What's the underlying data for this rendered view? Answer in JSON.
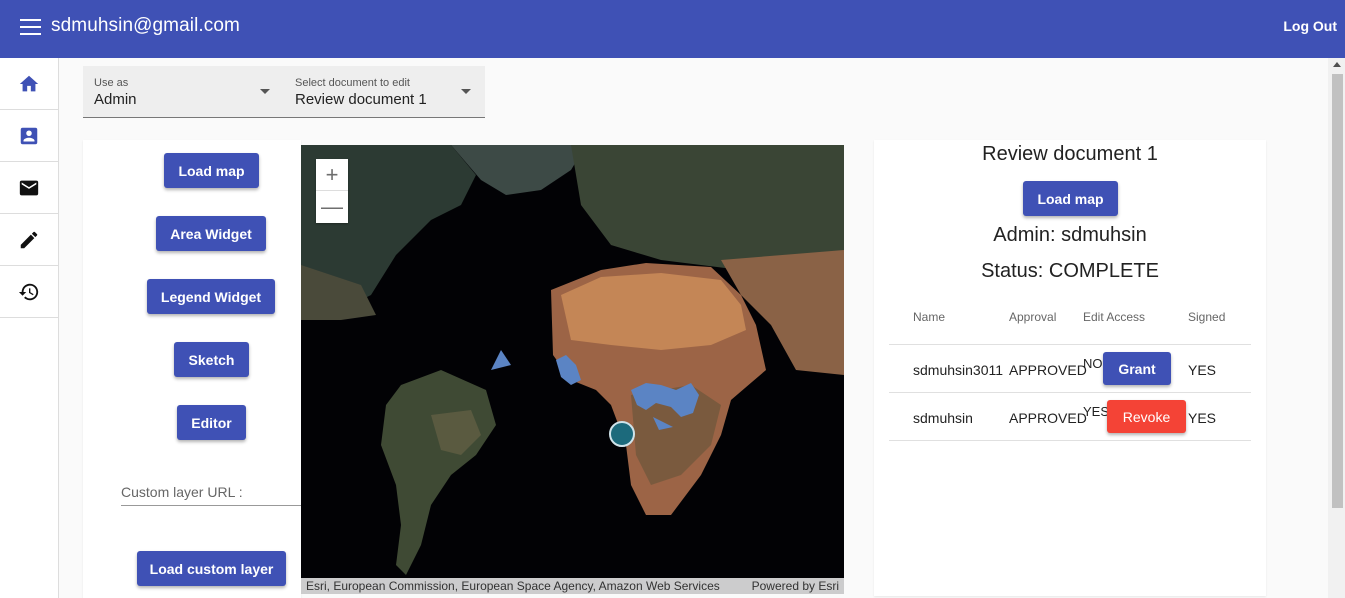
{
  "header": {
    "title": "sdmuhsin@gmail.com",
    "logout_label": "Log Out"
  },
  "drawer": {
    "items": [
      {
        "icon": "home-icon"
      },
      {
        "icon": "contact-icon"
      },
      {
        "icon": "mail-icon"
      },
      {
        "icon": "edit-icon"
      },
      {
        "icon": "history-icon"
      }
    ]
  },
  "selects": {
    "use_as": {
      "label": "Use as",
      "value": "Admin"
    },
    "document": {
      "label": "Select document to edit",
      "value": "Review document 1"
    }
  },
  "tools": {
    "load_map": "Load map",
    "area_widget": "Area Widget",
    "legend_widget": "Legend Widget",
    "sketch": "Sketch",
    "editor": "Editor",
    "custom_layer_placeholder": "Custom layer URL :",
    "load_custom_layer": "Load custom layer"
  },
  "map": {
    "zoom_in": "+",
    "zoom_out": "—",
    "attribution": "Esri, European Commission, European Space Agency, Amazon Web Services",
    "powered_by": "Powered by Esri"
  },
  "document_panel": {
    "title": "Review document 1",
    "load_map": "Load map",
    "admin_label": "Admin:",
    "admin_value": "sdmuhsin",
    "status_label": "Status:",
    "status_value": "COMPLETE",
    "columns": [
      "Name",
      "Approval",
      "Edit Access",
      "Signed"
    ],
    "rows": [
      {
        "name": "sdmuhsin3011",
        "approval": "APPROVED",
        "edit_access": "NO",
        "action": "Grant",
        "signed": "YES"
      },
      {
        "name": "sdmuhsin",
        "approval": "APPROVED",
        "edit_access": "YES",
        "action": "Revoke",
        "signed": "YES"
      }
    ]
  },
  "colors": {
    "primary": "#3f51b5",
    "danger": "#f44336"
  }
}
